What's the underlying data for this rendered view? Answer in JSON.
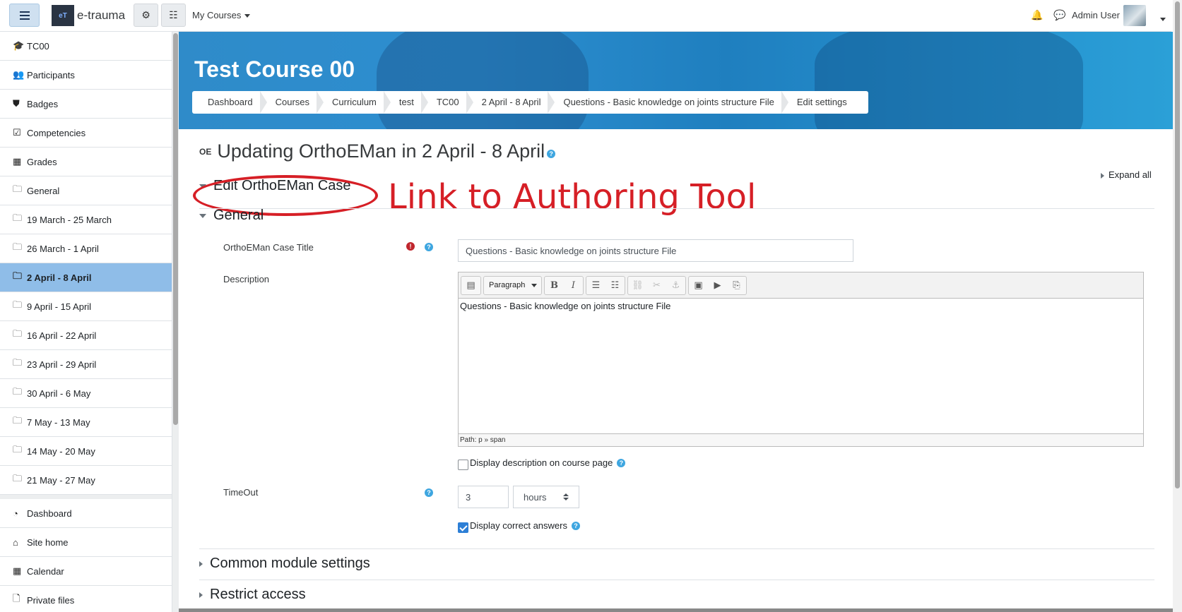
{
  "navbar": {
    "brand": "e-trauma",
    "my_courses": "My Courses",
    "user_name": "Admin User"
  },
  "drawer": {
    "items": [
      {
        "label": "TC00",
        "icon": "graduation-cap-icon"
      },
      {
        "label": "Participants",
        "icon": "users-icon"
      },
      {
        "label": "Badges",
        "icon": "shield-icon"
      },
      {
        "label": "Competencies",
        "icon": "check-square-icon"
      },
      {
        "label": "Grades",
        "icon": "table-icon"
      },
      {
        "label": "General",
        "icon": "folder-icon"
      },
      {
        "label": "19 March - 25 March",
        "icon": "folder-icon"
      },
      {
        "label": "26 March - 1 April",
        "icon": "folder-icon"
      },
      {
        "label": "2 April - 8 April",
        "icon": "folder-icon",
        "active": true
      },
      {
        "label": "9 April - 15 April",
        "icon": "folder-icon"
      },
      {
        "label": "16 April - 22 April",
        "icon": "folder-icon"
      },
      {
        "label": "23 April - 29 April",
        "icon": "folder-icon"
      },
      {
        "label": "30 April - 6 May",
        "icon": "folder-icon"
      },
      {
        "label": "7 May - 13 May",
        "icon": "folder-icon"
      },
      {
        "label": "14 May - 20 May",
        "icon": "folder-icon"
      },
      {
        "label": "21 May - 27 May",
        "icon": "folder-icon"
      }
    ],
    "global_items": [
      {
        "label": "Dashboard",
        "icon": "dashboard-icon"
      },
      {
        "label": "Site home",
        "icon": "home-icon"
      },
      {
        "label": "Calendar",
        "icon": "calendar-icon"
      },
      {
        "label": "Private files",
        "icon": "file-icon"
      }
    ]
  },
  "header": {
    "course_title": "Test Course 00",
    "breadcrumbs": [
      "Dashboard",
      "Courses",
      "Curriculum",
      "test",
      "TC00",
      "2 April - 8 April",
      "Questions - Basic knowledge on joints structure File",
      "Edit settings"
    ]
  },
  "main": {
    "module_icon_text": "OE",
    "page_heading": "Updating OrthoEMan in 2 April - 8 April",
    "expand_all": "Expand all",
    "edit_case_link": "Edit OrthoEMan Case",
    "annotation": "Link to Authoring Tool",
    "general_section": "General",
    "form": {
      "case_title_label": "OrthoEMan Case Title",
      "case_title_value": "Questions - Basic knowledge on joints structure File",
      "description_label": "Description",
      "editor_format": "Paragraph",
      "description_value": "Questions - Basic knowledge on joints structure File",
      "editor_path": "Path: p » span",
      "display_description_label": "Display description on course page",
      "display_description_checked": false,
      "timeout_label": "TimeOut",
      "timeout_value": "3",
      "timeout_unit": "hours",
      "display_answers_label": "Display correct answers",
      "display_answers_checked": true
    },
    "common_module_settings": "Common module settings",
    "restrict_access": "Restrict access"
  },
  "colors": {
    "accent": "#8fbde8",
    "annotation_red": "#d61f26",
    "help_blue": "#3ea6e0",
    "required_red": "#c0262d"
  }
}
